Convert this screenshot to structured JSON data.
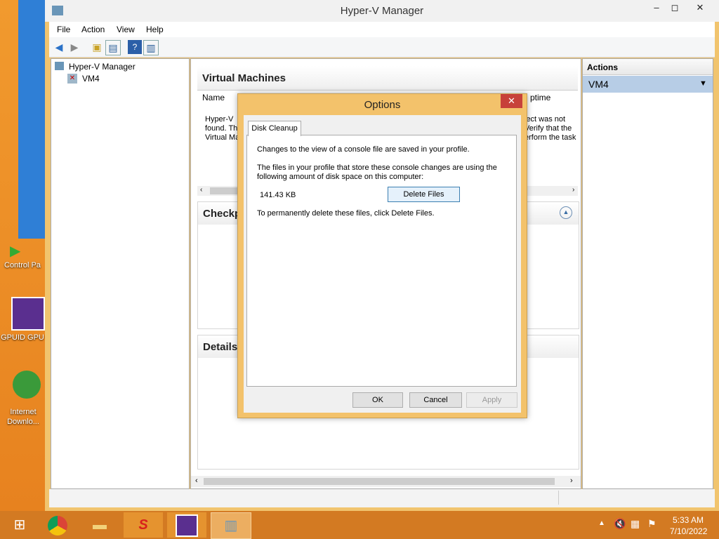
{
  "desktop": {
    "icons": [
      {
        "label": "Control Pa"
      },
      {
        "label": "GPUID GPU"
      },
      {
        "label": "Internet Downlo..."
      }
    ]
  },
  "window": {
    "title": "Hyper-V Manager",
    "menu": [
      "File",
      "Action",
      "View",
      "Help"
    ],
    "tree": {
      "root": "Hyper-V Manager",
      "child": "VM4"
    },
    "center": {
      "vm_header": "Virtual Machines",
      "columns": {
        "name": "Name",
        "uptime": "ptime"
      },
      "error_left": [
        "Hyper-V",
        "found. Th",
        "Virtual Ma"
      ],
      "error_right": [
        "ject was not",
        "Verify that the",
        "erform the task"
      ],
      "checkpoints_header": "Checkp",
      "details_header": "Details"
    },
    "actions": {
      "header": "Actions",
      "item": "VM4"
    }
  },
  "dialog": {
    "title": "Options",
    "tab": "Disk Cleanup",
    "line1": "Changes to the view of a console file are saved in your profile.",
    "line2a": "The files in your profile that store these console changes are using the",
    "line2b": "following amount of disk space on this computer:",
    "size": "141.43 KB",
    "delete_button": "Delete Files",
    "line3": "To permanently delete these files, click Delete Files.",
    "ok": "OK",
    "cancel": "Cancel",
    "apply": "Apply"
  },
  "taskbar": {
    "time": "5:33 AM",
    "date": "7/10/2022"
  }
}
